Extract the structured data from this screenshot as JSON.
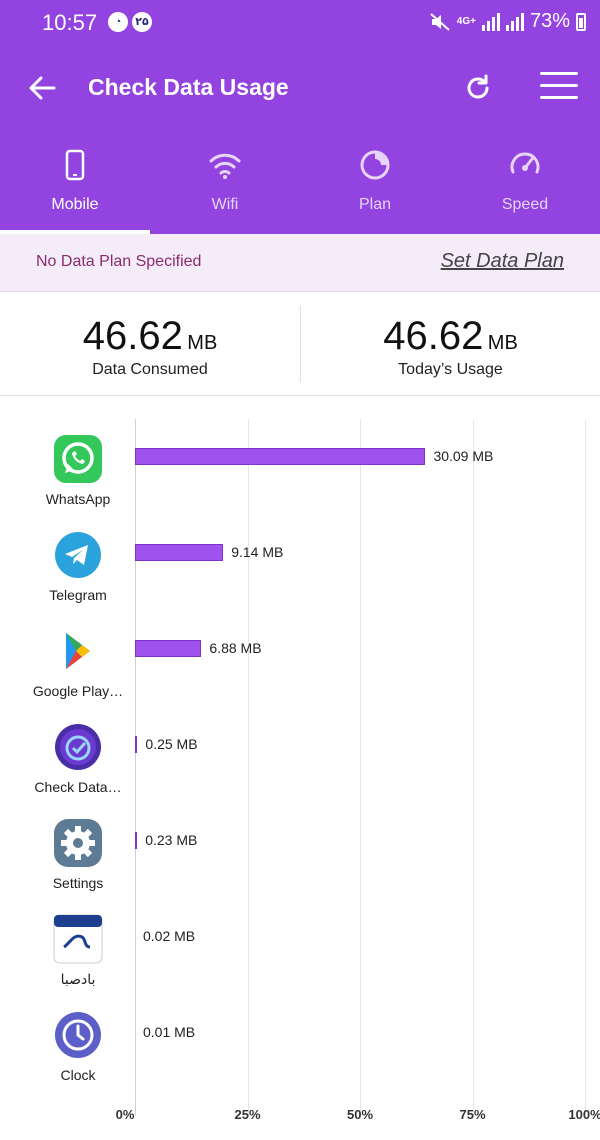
{
  "status_bar": {
    "time": "10:57",
    "notif_badge": "۲۵",
    "net_type": "4G+",
    "battery": "73%"
  },
  "app_bar": {
    "title": "Check Data Usage"
  },
  "tabs": [
    {
      "label": "Mobile",
      "icon": "phone-icon",
      "active": true
    },
    {
      "label": "Wifi",
      "icon": "wifi-icon",
      "active": false
    },
    {
      "label": "Plan",
      "icon": "plan-icon",
      "active": false
    },
    {
      "label": "Speed",
      "icon": "speedometer-icon",
      "active": false
    }
  ],
  "plan_banner": {
    "status": "No Data Plan Specified",
    "action": "Set Data Plan"
  },
  "summary": {
    "consumed_value": "46.62",
    "consumed_unit": "MB",
    "consumed_label": "Data Consumed",
    "today_value": "46.62",
    "today_unit": "MB",
    "today_label": "Today’s Usage"
  },
  "colors": {
    "primary": "#9243e0",
    "bar": "#a052ef",
    "plan_text": "#8a2c6c"
  },
  "chart_data": {
    "type": "bar",
    "orientation": "horizontal",
    "categories": [
      "WhatsApp",
      "Telegram",
      "Google Play…",
      "Check Data…",
      "Settings",
      "بادصبا",
      "Clock"
    ],
    "values": [
      30.09,
      9.14,
      6.88,
      0.25,
      0.23,
      0.02,
      0.01
    ],
    "value_labels": [
      "30.09 MB",
      "9.14 MB",
      "6.88 MB",
      "0.25 MB",
      "0.23 MB",
      "0.02 MB",
      "0.01 MB"
    ],
    "unit": "MB",
    "x_ticks": [
      "0%",
      "25%",
      "50%",
      "75%",
      "100%"
    ],
    "percent_of_total": 46.62,
    "grid": true
  }
}
